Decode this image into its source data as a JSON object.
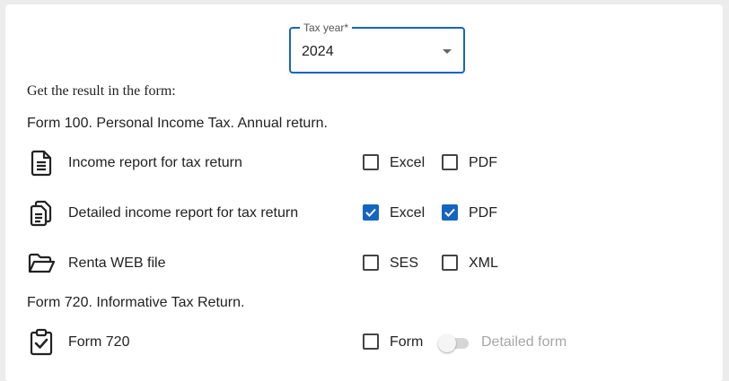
{
  "tax_year": {
    "label": "Tax year*",
    "value": "2024"
  },
  "intro_text": "Get the result in the form:",
  "sections": [
    {
      "title": "Form 100. Personal Income Tax. Annual return.",
      "rows": [
        {
          "icon": "document-icon",
          "label": "Income report for tax return",
          "options": [
            {
              "label": "Excel",
              "checked": false
            },
            {
              "label": "PDF",
              "checked": false
            }
          ]
        },
        {
          "icon": "documents-icon",
          "label": "Detailed income report for tax return",
          "options": [
            {
              "label": "Excel",
              "checked": true
            },
            {
              "label": "PDF",
              "checked": true
            }
          ]
        },
        {
          "icon": "folder-open-icon",
          "label": "Renta WEB file",
          "options": [
            {
              "label": "SES",
              "checked": false
            },
            {
              "label": "XML",
              "checked": false
            }
          ]
        }
      ]
    },
    {
      "title": "Form 720. Informative Tax Return.",
      "rows": [
        {
          "icon": "clipboard-check-icon",
          "label": "Form 720",
          "options": [
            {
              "label": "Form",
              "checked": false
            }
          ],
          "toggle": {
            "label": "Detailed form",
            "enabled": false,
            "on": false
          }
        }
      ]
    }
  ],
  "colors": {
    "accent": "#1565c0",
    "disabled_text": "#a6a6a6"
  }
}
